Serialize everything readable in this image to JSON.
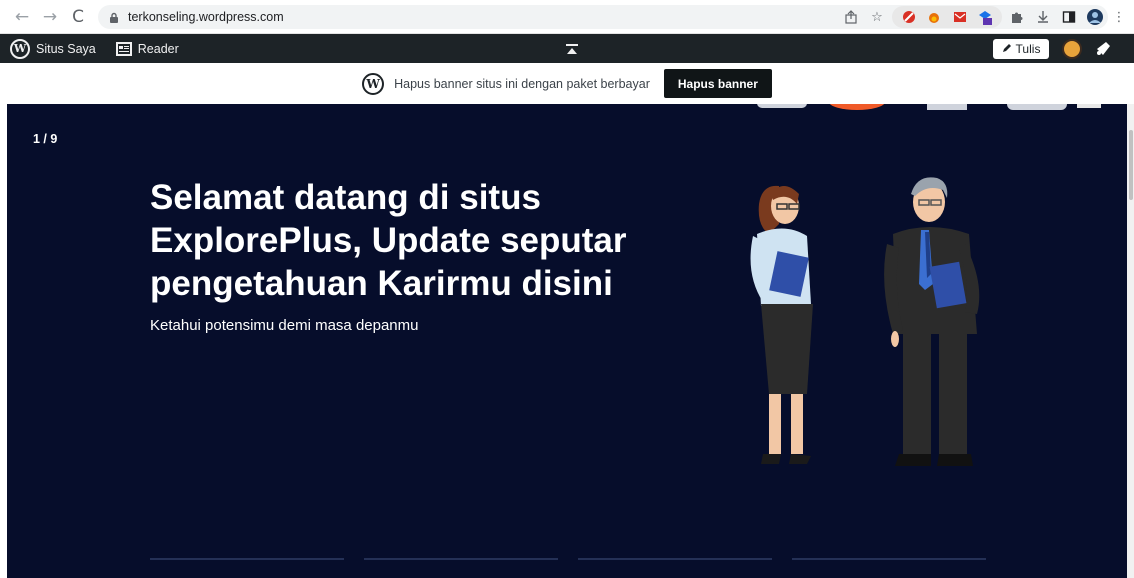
{
  "browser": {
    "url": "terkonseling.wordpress.com"
  },
  "admin_bar": {
    "my_site_label": "Situs Saya",
    "reader_label": "Reader",
    "write_label": "Tulis"
  },
  "banner": {
    "text": "Hapus banner situs ini dengan paket berbayar",
    "button_label": "Hapus banner"
  },
  "hero": {
    "counter": "1 / 9",
    "headline": "Selamat datang di situs ExplorePlus, Update seputar pengetahuan Karirmu disini",
    "subline": "Ketahui potensimu demi masa depanmu"
  },
  "colors": {
    "hero_bg": "#060d2b",
    "admin_bar_bg": "#1d2327",
    "banner_button_bg": "#101517"
  }
}
